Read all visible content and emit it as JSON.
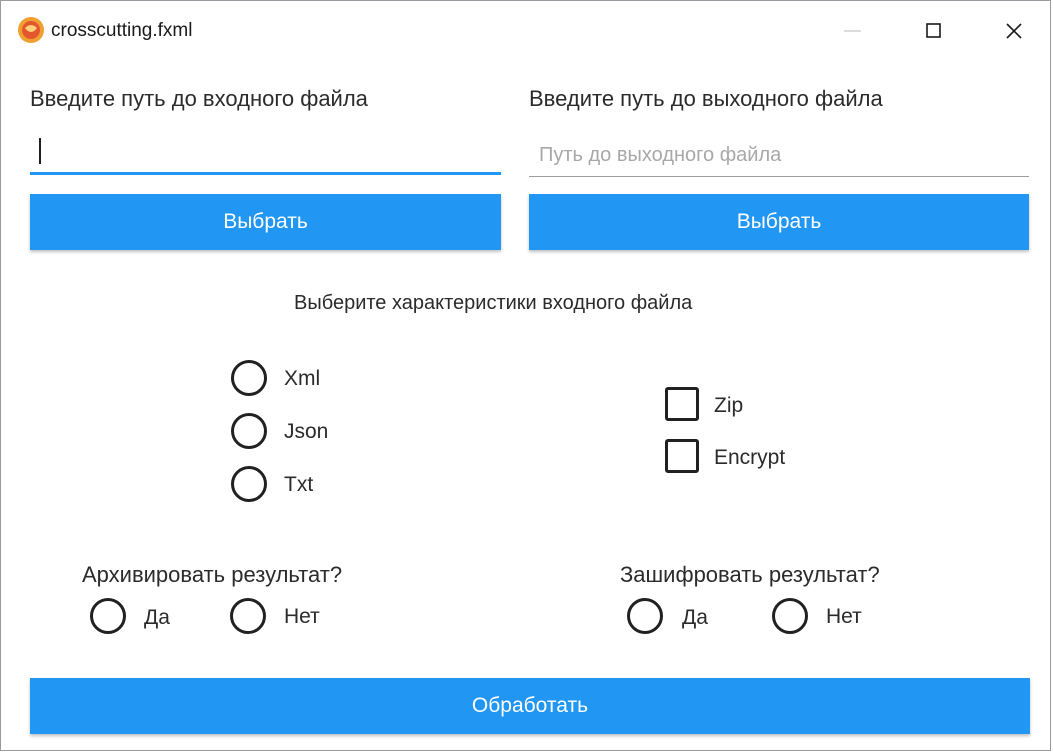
{
  "window": {
    "title": "crosscutting.fxml",
    "icons": {
      "app": "app-logo-icon",
      "minimize": "minimize-icon",
      "maximize": "maximize-icon",
      "close": "close-icon"
    }
  },
  "input_section": {
    "label": "Введите путь до входного файла",
    "value": "",
    "placeholder": "",
    "choose_button": "Выбрать"
  },
  "output_section": {
    "label": "Введите путь до выходного файла",
    "value": "",
    "placeholder": "Путь до выходного файла",
    "choose_button": "Выбрать"
  },
  "characteristics": {
    "heading": "Выберите характеристики входного файла",
    "formats": [
      "Xml",
      "Json",
      "Txt"
    ],
    "options": [
      "Zip",
      "Encrypt"
    ]
  },
  "archive": {
    "question": "Архивировать результат?",
    "yes": "Да",
    "no": "Нет"
  },
  "encrypt": {
    "question": "Зашифровать результат?",
    "yes": "Да",
    "no": "Нет"
  },
  "process_button": "Обработать",
  "colors": {
    "accent": "#2196f3",
    "button_text": "#ffffff",
    "control_stroke": "#212121"
  }
}
